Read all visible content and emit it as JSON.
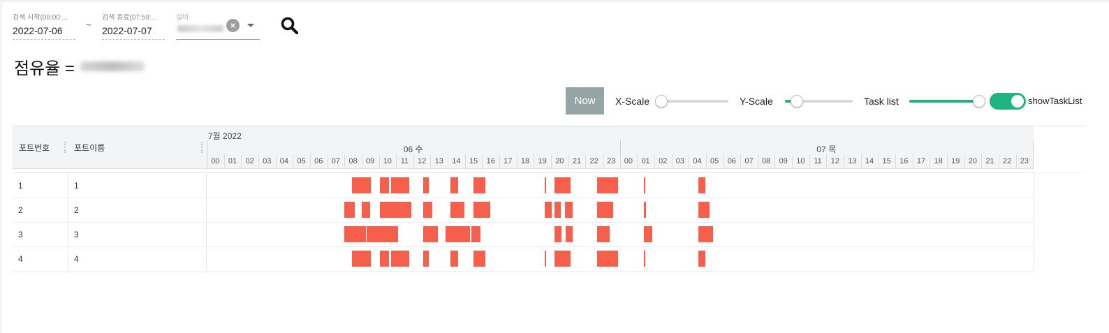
{
  "filters": {
    "start_label": "검색 시작(08:00:...",
    "start_value": "2022-07-06",
    "separator": "~",
    "end_label": "검색 종료(07:59:...",
    "end_value": "2022-07-07",
    "equipment_label": "설비"
  },
  "icons": {
    "search": "search-icon",
    "clear": "close-circle-icon",
    "dropdown": "caret-down-icon"
  },
  "occupancy": {
    "label": "점유율 ="
  },
  "controls": {
    "now_label": "Now",
    "x_scale_label": "X-Scale",
    "x_scale_value": 0.0,
    "y_scale_label": "Y-Scale",
    "y_scale_value": 0.18,
    "task_list_label": "Task list",
    "task_list_value": 1.0,
    "toggle_label": "showTaskList",
    "toggle_on": true
  },
  "colors": {
    "accent": "#1fb37f",
    "bar": "#f75f4d",
    "now_button": "#95a5a6",
    "header_bg": "#f3f4f5"
  },
  "gantt": {
    "columns": [
      "포트번호",
      "포트이름"
    ],
    "month": "7월 2022",
    "days": [
      "06 수",
      "07 목"
    ],
    "hours": [
      "00",
      "01",
      "02",
      "03",
      "04",
      "05",
      "06",
      "07",
      "08",
      "09",
      "10",
      "11",
      "12",
      "13",
      "14",
      "15",
      "16",
      "17",
      "18",
      "19",
      "20",
      "21",
      "22",
      "23"
    ],
    "rows": [
      {
        "no": "1",
        "name": "1",
        "tasks": [
          [
            8.45,
            9.55
          ],
          [
            10.05,
            10.58
          ],
          [
            10.72,
            11.78
          ],
          [
            12.57,
            12.92
          ],
          [
            14.15,
            14.6
          ],
          [
            15.48,
            16.2
          ],
          [
            19.62,
            19.72
          ],
          [
            20.2,
            21.12
          ],
          [
            22.68,
            23.88
          ],
          [
            25.38,
            25.47
          ],
          [
            28.58,
            28.98
          ]
        ]
      },
      {
        "no": "2",
        "name": "2",
        "tasks": [
          [
            8.0,
            8.62
          ],
          [
            9.0,
            9.48
          ],
          [
            10.05,
            10.9
          ],
          [
            10.93,
            11.9
          ],
          [
            12.57,
            13.1
          ],
          [
            14.15,
            14.95
          ],
          [
            15.48,
            16.48
          ],
          [
            19.62,
            20.05
          ],
          [
            20.2,
            20.58
          ],
          [
            20.8,
            21.25
          ],
          [
            22.68,
            23.62
          ],
          [
            25.38,
            25.5
          ],
          [
            28.58,
            29.2
          ]
        ]
      },
      {
        "no": "3",
        "name": "3",
        "tasks": [
          [
            8.0,
            8.42
          ],
          [
            8.45,
            9.27
          ],
          [
            9.3,
            10.2
          ],
          [
            10.05,
            11.1
          ],
          [
            12.57,
            13.42
          ],
          [
            13.88,
            14.22
          ],
          [
            14.25,
            15.3
          ],
          [
            15.38,
            15.92
          ],
          [
            20.2,
            20.6
          ],
          [
            20.85,
            21.25
          ],
          [
            22.68,
            23.4
          ],
          [
            25.38,
            25.88
          ],
          [
            28.58,
            29.4
          ]
        ]
      },
      {
        "no": "4",
        "name": "4",
        "tasks": [
          [
            8.45,
            9.55
          ],
          [
            10.05,
            10.58
          ],
          [
            10.72,
            11.78
          ],
          [
            12.57,
            12.92
          ],
          [
            14.15,
            14.6
          ],
          [
            15.48,
            16.2
          ],
          [
            19.62,
            19.72
          ],
          [
            20.2,
            21.12
          ],
          [
            22.68,
            23.88
          ],
          [
            25.38,
            25.47
          ],
          [
            28.58,
            28.98
          ]
        ]
      }
    ]
  }
}
